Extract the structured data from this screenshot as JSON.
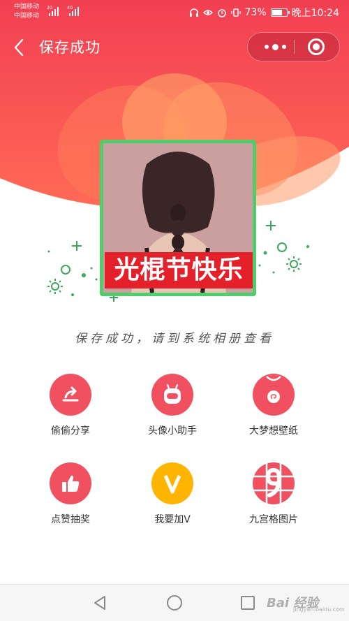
{
  "status_bar": {
    "carrier_1": "中国移动",
    "carrier_2": "中国移动",
    "net_1": "2G",
    "net_2": "4G",
    "battery_percent": "73%",
    "battery_level": 0.73,
    "time": "晚上10:24",
    "icons": [
      "headphones-icon",
      "eye-icon",
      "alarm-icon",
      "vibrate-icon"
    ]
  },
  "nav": {
    "title": "保存成功",
    "back_icon": "chevron-left-icon",
    "more_icon": "more-dots-icon",
    "close_icon": "target-close-icon"
  },
  "avatar": {
    "banner_text": "光棍节快乐",
    "frame_color": "#52cc6a",
    "banner_color": "#e4212b"
  },
  "saved_hint": "保存成功，请到系统相册查看",
  "features": [
    {
      "label": "偷偷分享",
      "icon": "share-icon",
      "color": "#f0505f"
    },
    {
      "label": "头像小助手",
      "icon": "robot-icon",
      "color": "#f0505f"
    },
    {
      "label": "大梦想壁纸",
      "icon": "shirt-icon",
      "color": "#f0505f"
    },
    {
      "label": "点赞抽奖",
      "icon": "thumbs-up-icon",
      "color": "#f0505f"
    },
    {
      "label": "我要加V",
      "icon": "v-badge-icon",
      "color": "#ffb400"
    },
    {
      "label": "九宫格图片",
      "icon": "nine-grid-icon",
      "color": "#f0505f"
    }
  ],
  "system_nav": {
    "back": "back-triangle-icon",
    "home": "home-circle-icon",
    "recent": "recent-square-icon"
  },
  "watermark": {
    "text": "Bai 经验",
    "sub": "jingyan.baidu.com"
  },
  "colors": {
    "header_red": "#f04a55",
    "petal_orange": "#ff8a5c",
    "accent_green": "#52cc6a"
  }
}
